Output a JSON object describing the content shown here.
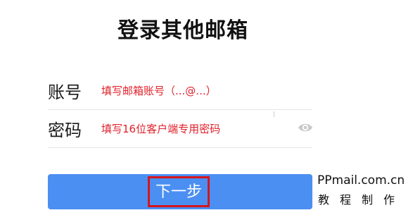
{
  "page": {
    "title": "登录其他邮箱"
  },
  "form": {
    "account": {
      "label": "账号",
      "placeholder": "填写邮箱账号（...@...）"
    },
    "password": {
      "label": "密码",
      "placeholder": "填写16位客户端专用密码",
      "toggle_icon": "eye-icon"
    }
  },
  "next_button": {
    "label": "下一步"
  },
  "watermark": {
    "domain": "PPmail.com.cn",
    "subtitle": "教程制作"
  },
  "colors": {
    "placeholder_text": "#e0202a",
    "button_bg": "#4b8ff2",
    "highlight_border": "#d6151c"
  }
}
